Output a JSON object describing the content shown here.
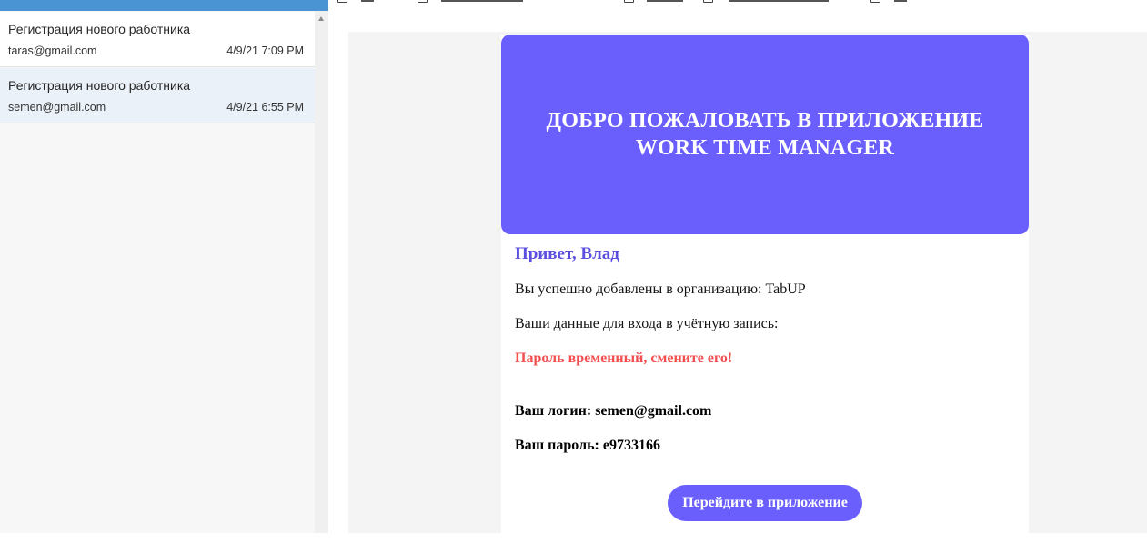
{
  "message_list": {
    "items": [
      {
        "subject": "Регистрация нового работника",
        "from": "taras@gmail.com",
        "date": "4/9/21 7:09 PM",
        "selected": false
      },
      {
        "subject": "Регистрация нового работника",
        "from": "semen@gmail.com",
        "date": "4/9/21 6:55 PM",
        "selected": true
      }
    ]
  },
  "email": {
    "hero_title": "ДОБРО ПОЖАЛОВАТЬ В ПРИЛОЖЕНИЕ WORK TIME MANAGER",
    "greeting": "Привет, Влад",
    "added_text": "Вы успешно добавлены в организацию: TabUP",
    "credentials_intro": "Ваши данные для входа в учётную запись:",
    "temp_password_warning": "Пароль временный, смените его!",
    "login_line": "Ваш логин: semen@gmail.com",
    "password_line": "Ваш пароль: e9733166",
    "cta_label": "Перейдите в приложение"
  },
  "colors": {
    "accent": "#6a5ffd",
    "greeting": "#5b4fe0",
    "warning": "#f24e4e",
    "list_header": "#4a94d4",
    "selected_row": "#eaf1f9"
  }
}
